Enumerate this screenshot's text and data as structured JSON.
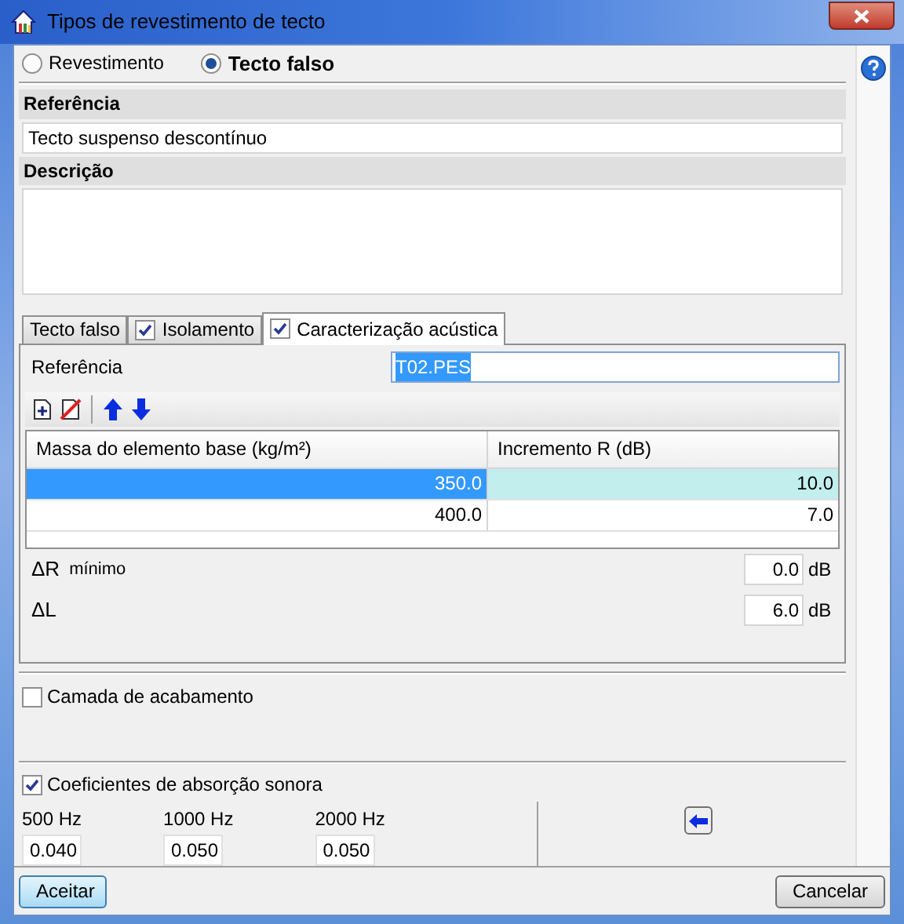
{
  "window": {
    "title": "Tipos de revestimento de tecto"
  },
  "mode_options": [
    {
      "label": "Revestimento",
      "selected": false
    },
    {
      "label": "Tecto falso",
      "selected": true
    }
  ],
  "reference": {
    "label": "Referência",
    "value": "Tecto suspenso descontínuo"
  },
  "description": {
    "label": "Descrição"
  },
  "tabs": [
    {
      "label": "Tecto falso",
      "kind": "plain",
      "selected": false
    },
    {
      "label": "Isolamento",
      "kind": "checkbox",
      "checked": true,
      "selected": false
    },
    {
      "label": "Caracterização acústica",
      "kind": "checkbox",
      "checked": true,
      "selected": true
    }
  ],
  "acoustic": {
    "reference_label": "Referência",
    "reference_value": "T02.PES",
    "table": {
      "columns": [
        "Massa do elemento base (kg/m²)",
        "Incremento R (dB)"
      ],
      "rows": [
        {
          "cells": [
            "350.0",
            "10.0"
          ],
          "selected": true
        },
        {
          "cells": [
            "400.0",
            "7.0"
          ],
          "selected": false
        }
      ]
    },
    "fields": [
      {
        "label": "ΔR",
        "sublabel": "mínimo",
        "value": "0.0",
        "unit": "dB"
      },
      {
        "label": "ΔL",
        "value": "6.0",
        "unit": "dB"
      }
    ]
  },
  "finish_layer": {
    "label": "Camada de acabamento",
    "checked": false
  },
  "absorption": {
    "label": "Coeficientes de absorção sonora",
    "checked": true,
    "bands": [
      {
        "label": "500 Hz",
        "value": "0.040"
      },
      {
        "label": "1000 Hz",
        "value": "0.050"
      },
      {
        "label": "2000 Hz",
        "value": "0.050"
      }
    ]
  },
  "buttons": [
    {
      "label": "Aceitar",
      "default": true
    },
    {
      "label": "Cancelar",
      "default": false
    }
  ]
}
